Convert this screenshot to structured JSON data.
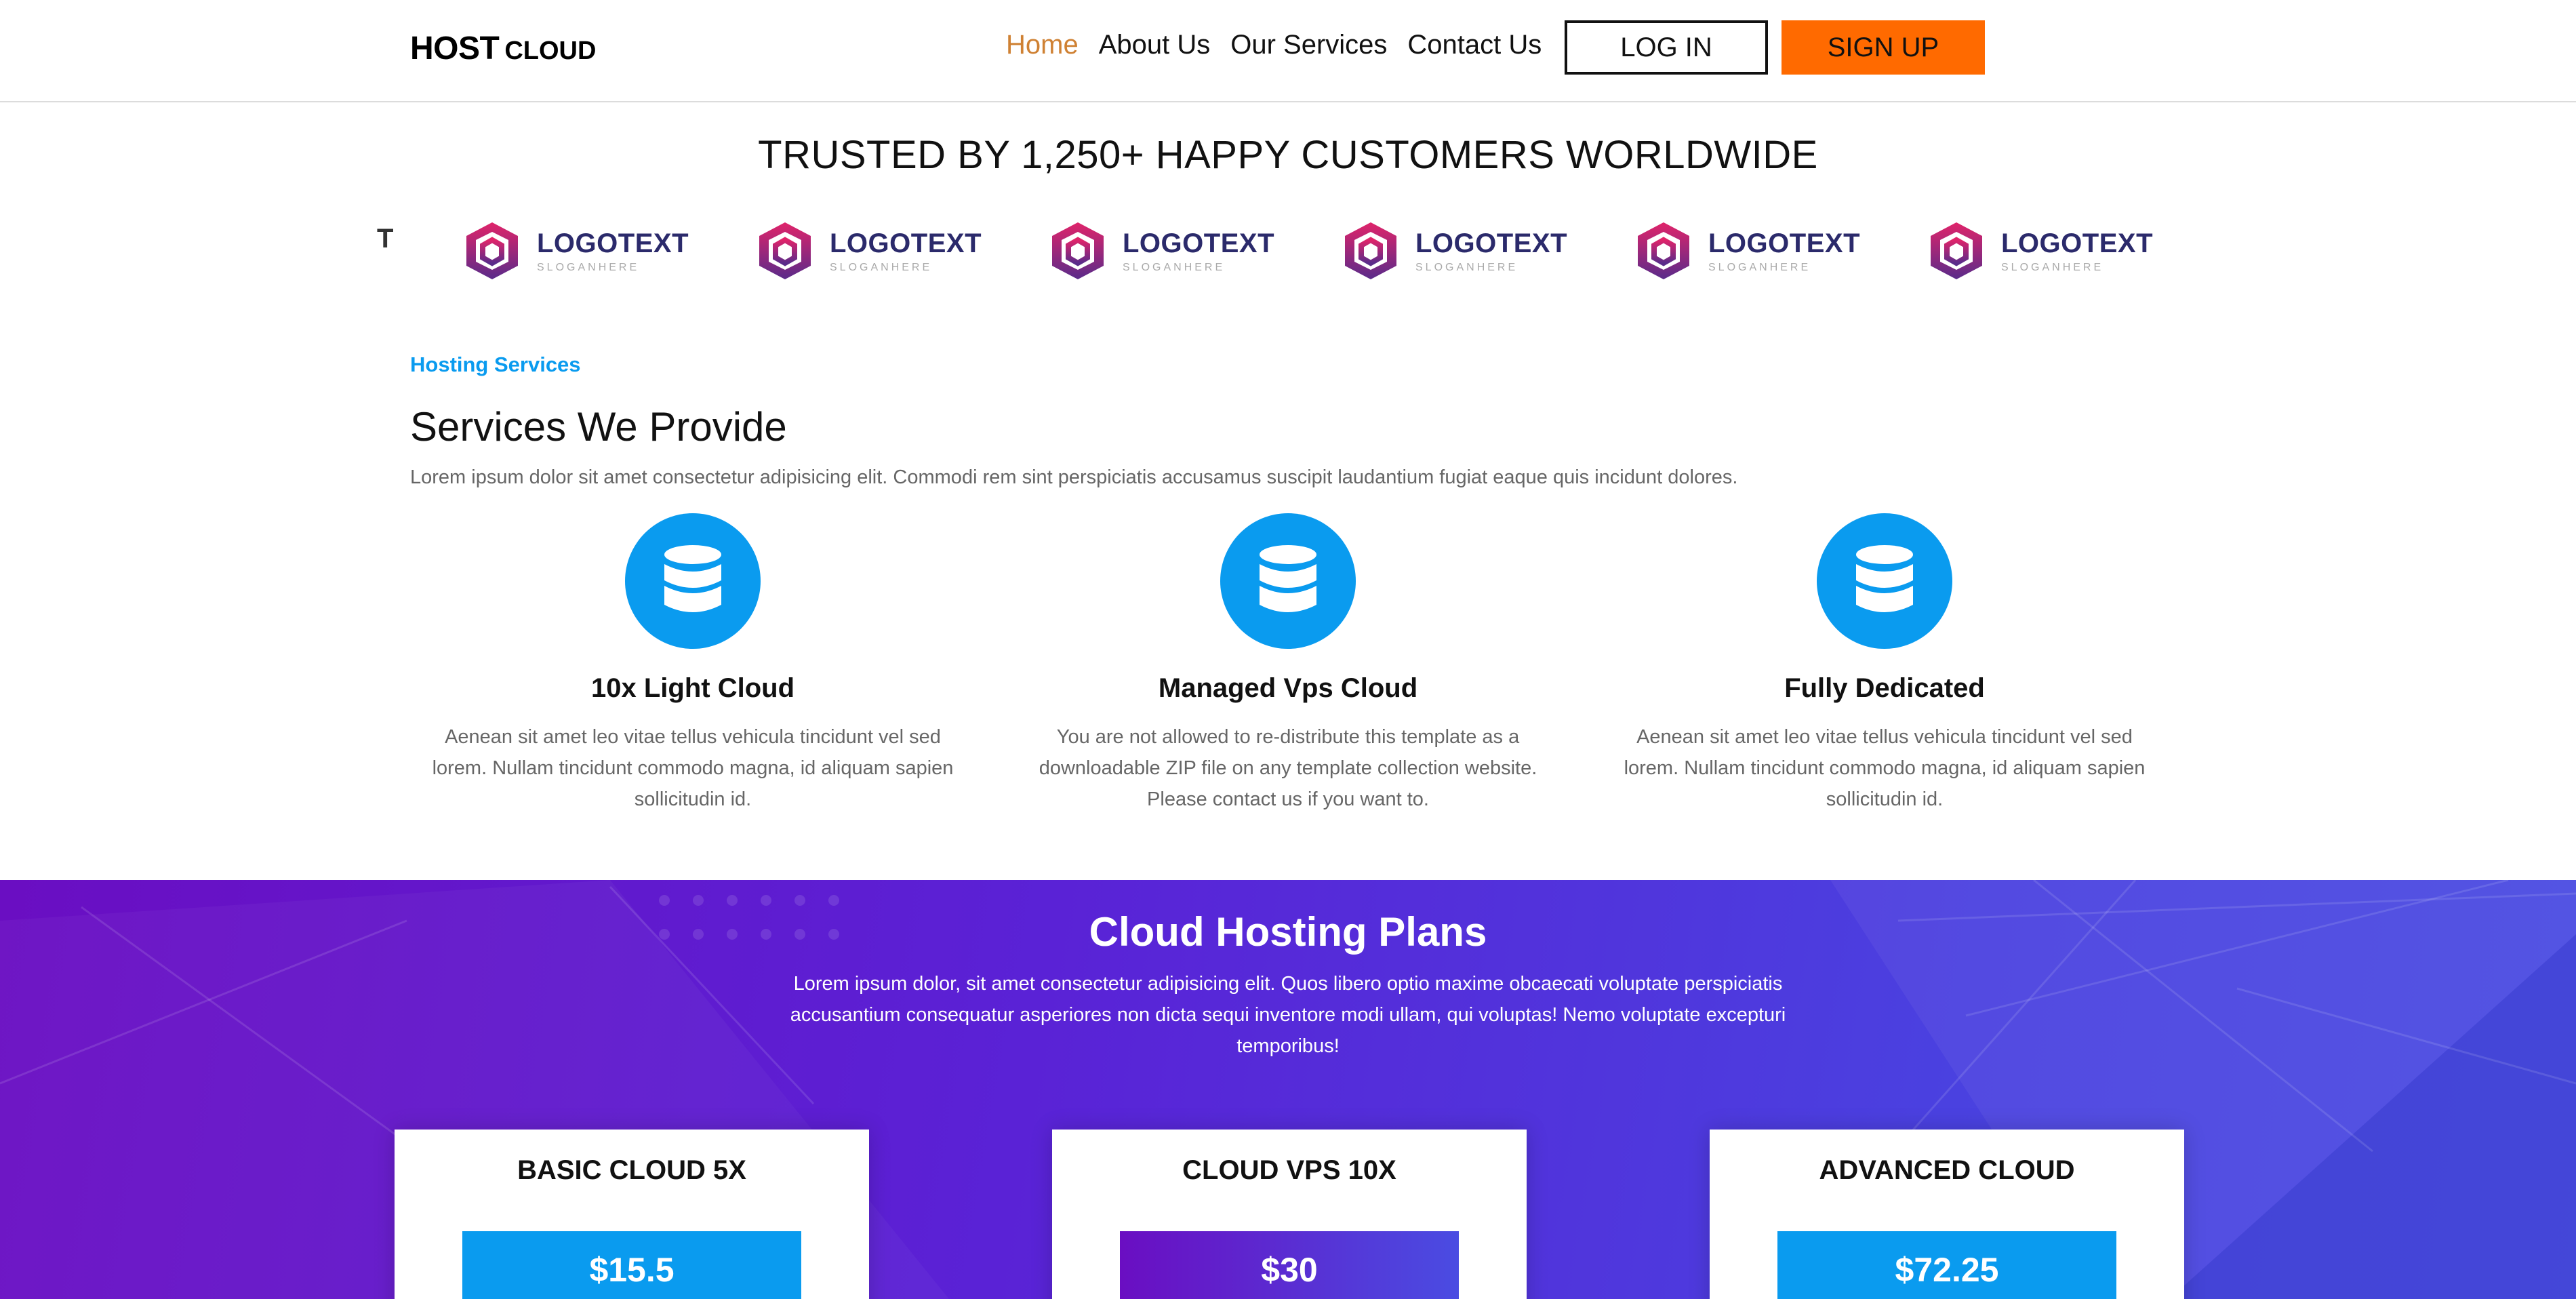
{
  "header": {
    "logo_main": "HOST",
    "logo_sub": "CLOUD",
    "nav": [
      "Home",
      "About Us",
      "Our Services",
      "Contact Us"
    ],
    "active_nav": "Home",
    "login_label": "LOG IN",
    "signup_label": "SIGN UP",
    "colors": {
      "active": "#cf8133",
      "signup_bg": "#ff6a00"
    }
  },
  "trusted": {
    "title": "TRUSTED BY 1,250+ HAPPY CUSTOMERS WORLDWIDE",
    "cut_letter": "T",
    "logos": [
      {
        "name": "LOGOTEXT",
        "slogan": "SLOGANHERE"
      },
      {
        "name": "LOGOTEXT",
        "slogan": "SLOGANHERE"
      },
      {
        "name": "LOGOTEXT",
        "slogan": "SLOGANHERE"
      },
      {
        "name": "LOGOTEXT",
        "slogan": "SLOGANHERE"
      },
      {
        "name": "LOGOTEXT",
        "slogan": "SLOGANHERE"
      },
      {
        "name": "LOGOTEXT",
        "slogan": "SLOGANHERE"
      }
    ]
  },
  "services": {
    "eyebrow": "Hosting Services",
    "title": "Services We Provide",
    "description": "Lorem ipsum dolor sit amet consectetur adipisicing elit. Commodi rem sint perspiciatis accusamus suscipit laudantium fugiat eaque quis incidunt dolores.",
    "icon": "database-icon",
    "accent": "#0a9bef",
    "items": [
      {
        "name": "10x Light Cloud",
        "text": "Aenean sit amet leo vitae tellus vehicula tincidunt vel sed lorem. Nullam tincidunt commodo magna, id aliquam sapien sollicitudin id."
      },
      {
        "name": "Managed Vps Cloud",
        "text": "You are not allowed to re-distribute this template as a downloadable ZIP file on any template collection website. Please contact us if you want to."
      },
      {
        "name": "Fully Dedicated",
        "text": "Aenean sit amet leo vitae tellus vehicula tincidunt vel sed lorem. Nullam tincidunt commodo magna, id aliquam sapien sollicitudin id."
      }
    ]
  },
  "plans": {
    "title": "Cloud Hosting Plans",
    "description": "Lorem ipsum dolor, sit amet consectetur adipisicing elit. Quos libero optio maxime obcaecati voluptate perspiciatis accusantium consequatur asperiores non dicta sequi inventore modi ullam, qui voluptas! Nemo voluptate excepturi temporibus!",
    "items": [
      {
        "name": "BASIC CLOUD 5X",
        "price": "$15.5"
      },
      {
        "name": "CLOUD VPS 10X",
        "price": "$30"
      },
      {
        "name": "ADVANCED CLOUD",
        "price": "$72.25"
      }
    ]
  }
}
